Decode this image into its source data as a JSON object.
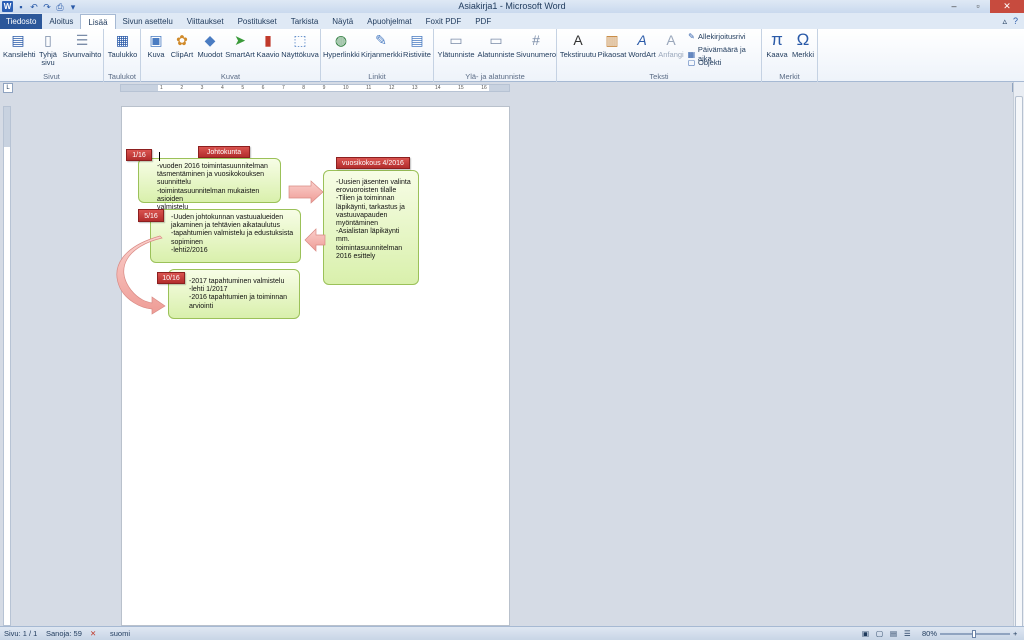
{
  "window": {
    "title": "Asiakirja1 - Microsoft Word",
    "app_icon_letter": "W"
  },
  "tabs": [
    {
      "label": "Tiedosto"
    },
    {
      "label": "Aloitus"
    },
    {
      "label": "Lisää"
    },
    {
      "label": "Sivun asettelu"
    },
    {
      "label": "Viittaukset"
    },
    {
      "label": "Postitukset"
    },
    {
      "label": "Tarkista"
    },
    {
      "label": "Näytä"
    },
    {
      "label": "Apuohjelmat"
    },
    {
      "label": "Foxit PDF"
    },
    {
      "label": "PDF"
    }
  ],
  "ribbon": {
    "groups": {
      "pages": "Sivut",
      "tables": "Taulukot",
      "illustrations": "Kuvat",
      "links": "Linkit",
      "header_footer": "Ylä- ja alatunniste",
      "text": "Teksti",
      "symbols": "Merkit"
    },
    "buttons": {
      "cover": "Kansilehti",
      "blank": "Tyhjä",
      "blank2": "sivu",
      "pagebreak": "Sivunvaihto",
      "table": "Taulukko",
      "picture": "Kuva",
      "clipart": "ClipArt",
      "shapes": "Muodot",
      "smartart": "SmartArt",
      "chart": "Kaavio",
      "screenshot": "Näyttökuva",
      "hyperlink": "Hyperlinkki",
      "bookmark": "Kirjanmerkki",
      "crossref": "Ristiviite",
      "header": "Ylätunniste",
      "footer": "Alatunniste",
      "pagenumber": "Sivunumero",
      "textbox": "Tekstiruutu",
      "quickparts": "Pikaosat",
      "wordart": "WordArt",
      "dropcap": "Anfangi",
      "signature": "Allekirjoitusrivi",
      "datetime": "Päivämäärä ja aika",
      "object": "Objekti",
      "equation": "Kaava",
      "symbol": "Merkki"
    }
  },
  "diagram": {
    "johtokunta_label": "Johtokunta",
    "box1": {
      "tag": "1/16",
      "lines": [
        "-vuoden 2016 toimintasuunnitelman",
        "täsmentäminen ja vuosikokouksen suunnittelu",
        "-toimintasuunnitelman mukaisten asioiden",
        "valmistelu"
      ]
    },
    "box2": {
      "tag": "vuosikokous 4/2016",
      "lines": [
        "-Uusien jäsenten valinta",
        "erovuoroisten tilalle",
        "-Tilien ja toiminnan",
        "läpikäynti, tarkastus ja",
        "vastuuvapauden",
        "myöntäminen",
        "-Asialistan läpikäynti",
        "mm.",
        "toimintasuunnitelman",
        "2016 esittely"
      ]
    },
    "box3": {
      "tag": "5/16",
      "lines": [
        "-Uuden johtokunnan vastuualueiden",
        "jakaminen ja tehtävien aikataulutus",
        "-tapahtumien valmistelu ja edustuksista",
        "sopiminen",
        "-lehti2/2016"
      ]
    },
    "box4": {
      "tag": "10/16",
      "lines": [
        "-2017 tapahtuminen valmistelu",
        "-lehti 1/2017",
        "-2016 tapahtumien ja toiminnan",
        "arviointi"
      ]
    }
  },
  "statusbar": {
    "page": "Sivu: 1 / 1",
    "words": "Sanoja: 59",
    "language": "suomi",
    "zoom": "80%"
  },
  "colors": {
    "box_fill": "#d9f0ac",
    "box_border": "#9bc159",
    "tag_fill": "#c0392b",
    "arrow_fill": "#f5b5b0"
  }
}
